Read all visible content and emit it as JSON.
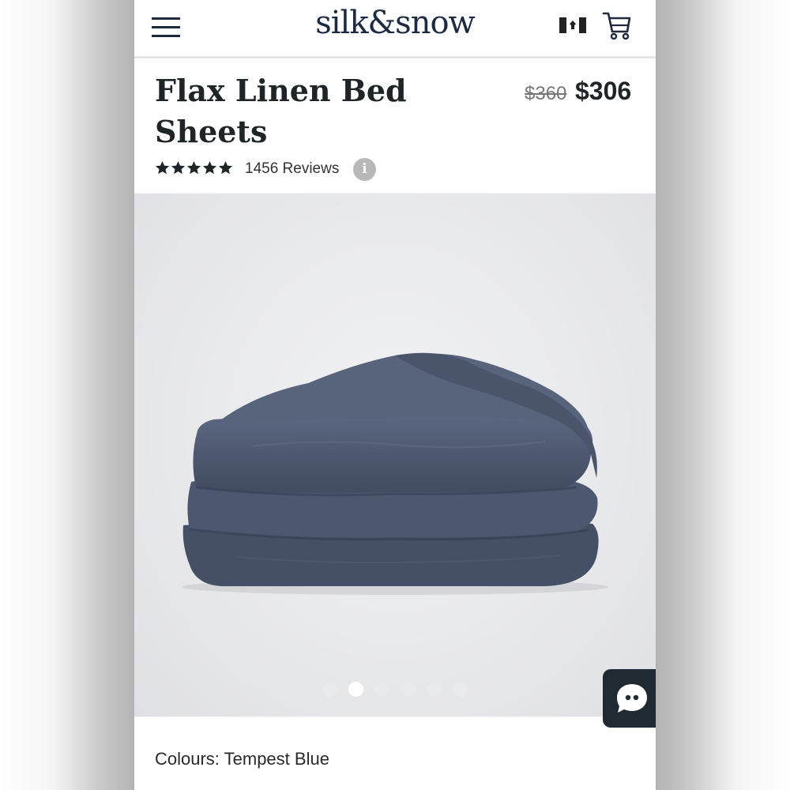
{
  "brand": {
    "name": "silk&snow"
  },
  "header": {
    "menu_icon": "hamburger-menu-icon",
    "flag_icon": "canada-flag-icon",
    "cart_icon": "shopping-cart-icon"
  },
  "product": {
    "title": "Flax Linen Bed Sheets",
    "price_original": "$360",
    "price_sale": "$306",
    "rating_stars": 5,
    "reviews_label": "1456 Reviews",
    "info_label": "i"
  },
  "gallery": {
    "image_count": 6,
    "active_index": 1
  },
  "colours": {
    "label": "Colours: Tempest Blue"
  },
  "colors": {
    "accent": "#1d2a44",
    "product_fabric": "#4f5a73",
    "chat_button": "#1f2a32"
  }
}
